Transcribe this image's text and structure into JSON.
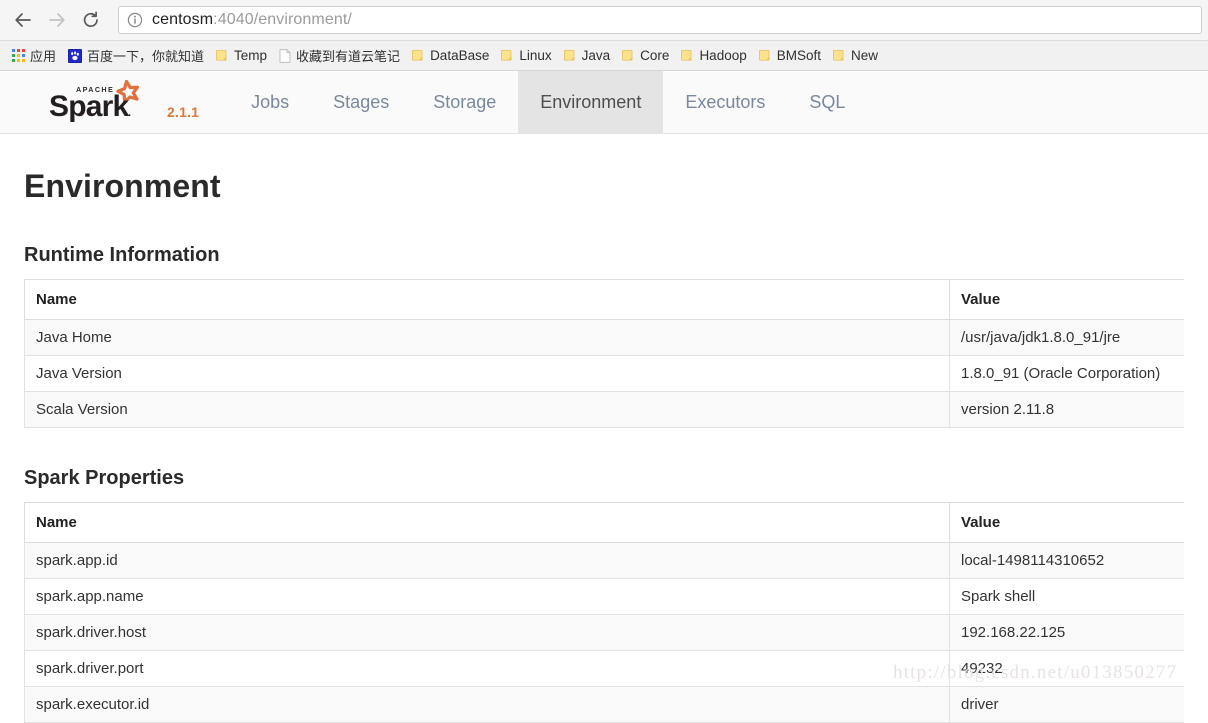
{
  "browser": {
    "back_tooltip": "Back",
    "forward_tooltip": "Forward",
    "reload_tooltip": "Reload",
    "url_host": "centosm",
    "url_path": ":4040/environment/",
    "security_icon": "info-circle-icon"
  },
  "bookmarks": [
    {
      "label": "应用",
      "icon": "apps-grid-icon",
      "cn": true
    },
    {
      "label": "百度一下，你就知道",
      "icon": "baidu-paw-icon",
      "cn": true
    },
    {
      "label": "Temp",
      "icon": "folder-icon",
      "cn": false
    },
    {
      "label": "收藏到有道云笔记",
      "icon": "page-icon",
      "cn": true
    },
    {
      "label": "DataBase",
      "icon": "folder-icon",
      "cn": false
    },
    {
      "label": "Linux",
      "icon": "folder-icon",
      "cn": false
    },
    {
      "label": "Java",
      "icon": "folder-icon",
      "cn": false
    },
    {
      "label": "Core",
      "icon": "folder-icon",
      "cn": false
    },
    {
      "label": "Hadoop",
      "icon": "folder-icon",
      "cn": false
    },
    {
      "label": "BMSoft",
      "icon": "folder-icon",
      "cn": false
    },
    {
      "label": "New",
      "icon": "folder-icon",
      "cn": false
    }
  ],
  "spark": {
    "brand_apache": "APACHE",
    "brand_name": "Spark",
    "version": "2.1.1",
    "nav": [
      {
        "label": "Jobs",
        "active": false
      },
      {
        "label": "Stages",
        "active": false
      },
      {
        "label": "Storage",
        "active": false
      },
      {
        "label": "Environment",
        "active": true
      },
      {
        "label": "Executors",
        "active": false
      },
      {
        "label": "SQL",
        "active": false
      }
    ]
  },
  "page": {
    "title": "Environment",
    "sections": [
      {
        "heading": "Runtime Information",
        "columns": [
          "Name",
          "Value"
        ],
        "rows": [
          [
            "Java Home",
            "/usr/java/jdk1.8.0_91/jre"
          ],
          [
            "Java Version",
            "1.8.0_91 (Oracle Corporation)"
          ],
          [
            "Scala Version",
            "version 2.11.8"
          ]
        ]
      },
      {
        "heading": "Spark Properties",
        "columns": [
          "Name",
          "Value"
        ],
        "rows": [
          [
            "spark.app.id",
            "local-1498114310652"
          ],
          [
            "spark.app.name",
            "Spark shell"
          ],
          [
            "spark.driver.host",
            "192.168.22.125"
          ],
          [
            "spark.driver.port",
            "49232"
          ],
          [
            "spark.executor.id",
            "driver"
          ]
        ]
      }
    ]
  },
  "watermark": "http://blog.csdn.net/u013850277",
  "colors": {
    "accent_orange": "#d9783b",
    "nav_link": "#7a889c",
    "active_tab_bg": "#e4e4e4"
  }
}
